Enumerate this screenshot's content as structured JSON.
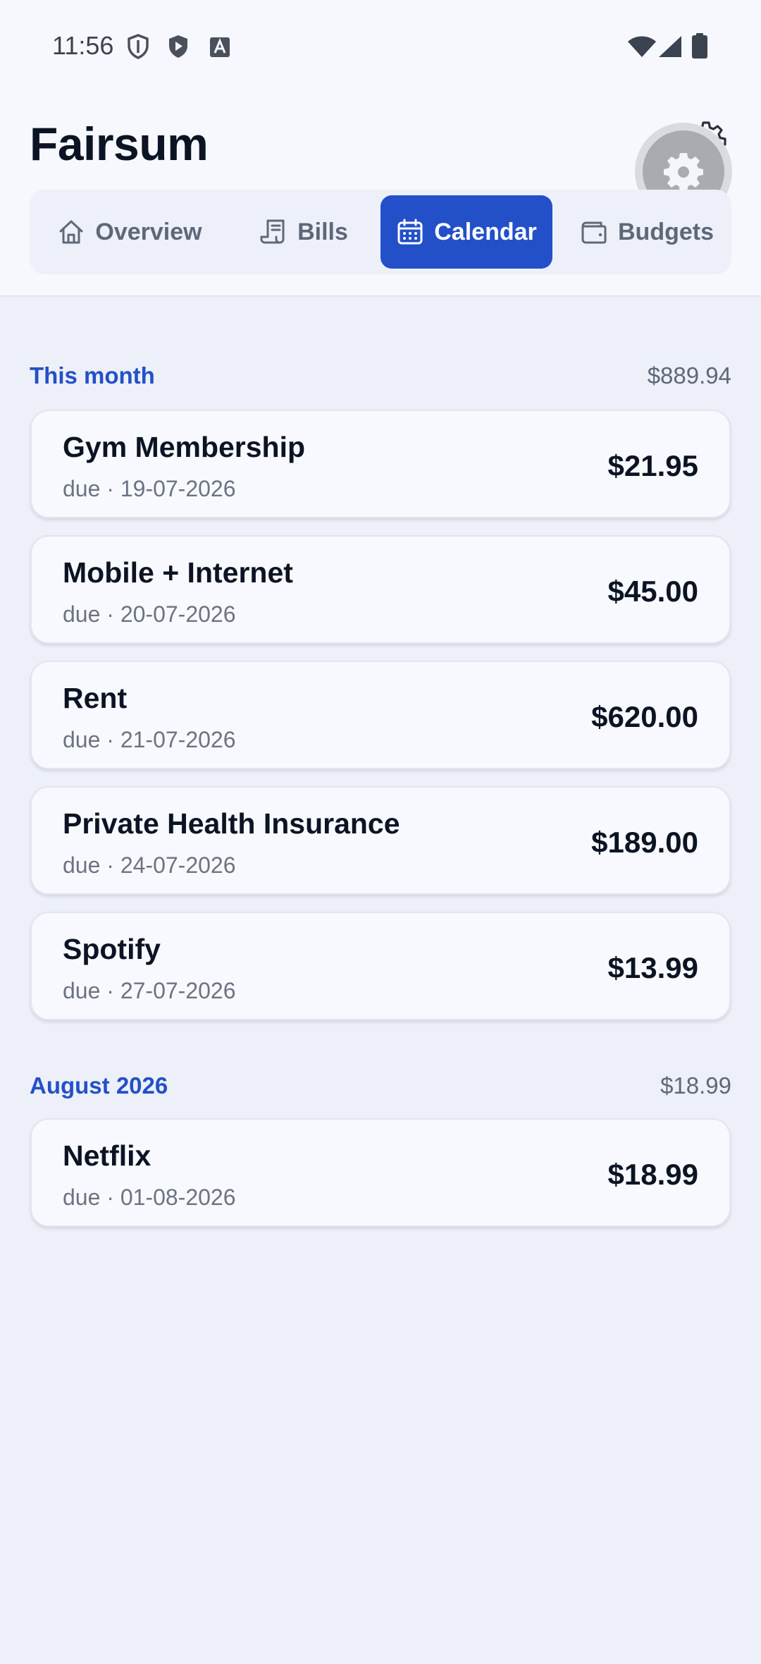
{
  "status_bar": {
    "time": "11:56",
    "icons_left": [
      "shield-outline-icon",
      "shield-play-icon",
      "text-a-icon"
    ],
    "icons_right": [
      "wifi-icon",
      "cell-signal-icon",
      "battery-icon"
    ]
  },
  "app": {
    "title": "Fairsum"
  },
  "tabs": [
    {
      "label": "Overview",
      "icon": "home-icon",
      "active": false
    },
    {
      "label": "Bills",
      "icon": "receipt-icon",
      "active": false
    },
    {
      "label": "Calendar",
      "icon": "calendar-icon",
      "active": true
    },
    {
      "label": "Budgets",
      "icon": "wallet-icon",
      "active": false
    }
  ],
  "sections": [
    {
      "title": "This month",
      "total": "$889.94",
      "bills": [
        {
          "name": "Gym Membership",
          "due": "due · 19-07-2026",
          "amount": "$21.95"
        },
        {
          "name": "Mobile + Internet",
          "due": "due · 20-07-2026",
          "amount": "$45.00"
        },
        {
          "name": "Rent",
          "due": "due · 21-07-2026",
          "amount": "$620.00"
        },
        {
          "name": "Private Health Insurance",
          "due": "due · 24-07-2026",
          "amount": "$189.00"
        },
        {
          "name": "Spotify",
          "due": "due · 27-07-2026",
          "amount": "$13.99"
        }
      ]
    },
    {
      "title": "August 2026",
      "total": "$18.99",
      "bills": [
        {
          "name": "Netflix",
          "due": "due · 01-08-2026",
          "amount": "$18.99"
        }
      ]
    }
  ],
  "colors": {
    "accent": "#2350c9",
    "background": "#edf0f8",
    "card": "#f8f9fe",
    "text_primary": "#0c1424",
    "text_secondary": "#6b7382"
  }
}
